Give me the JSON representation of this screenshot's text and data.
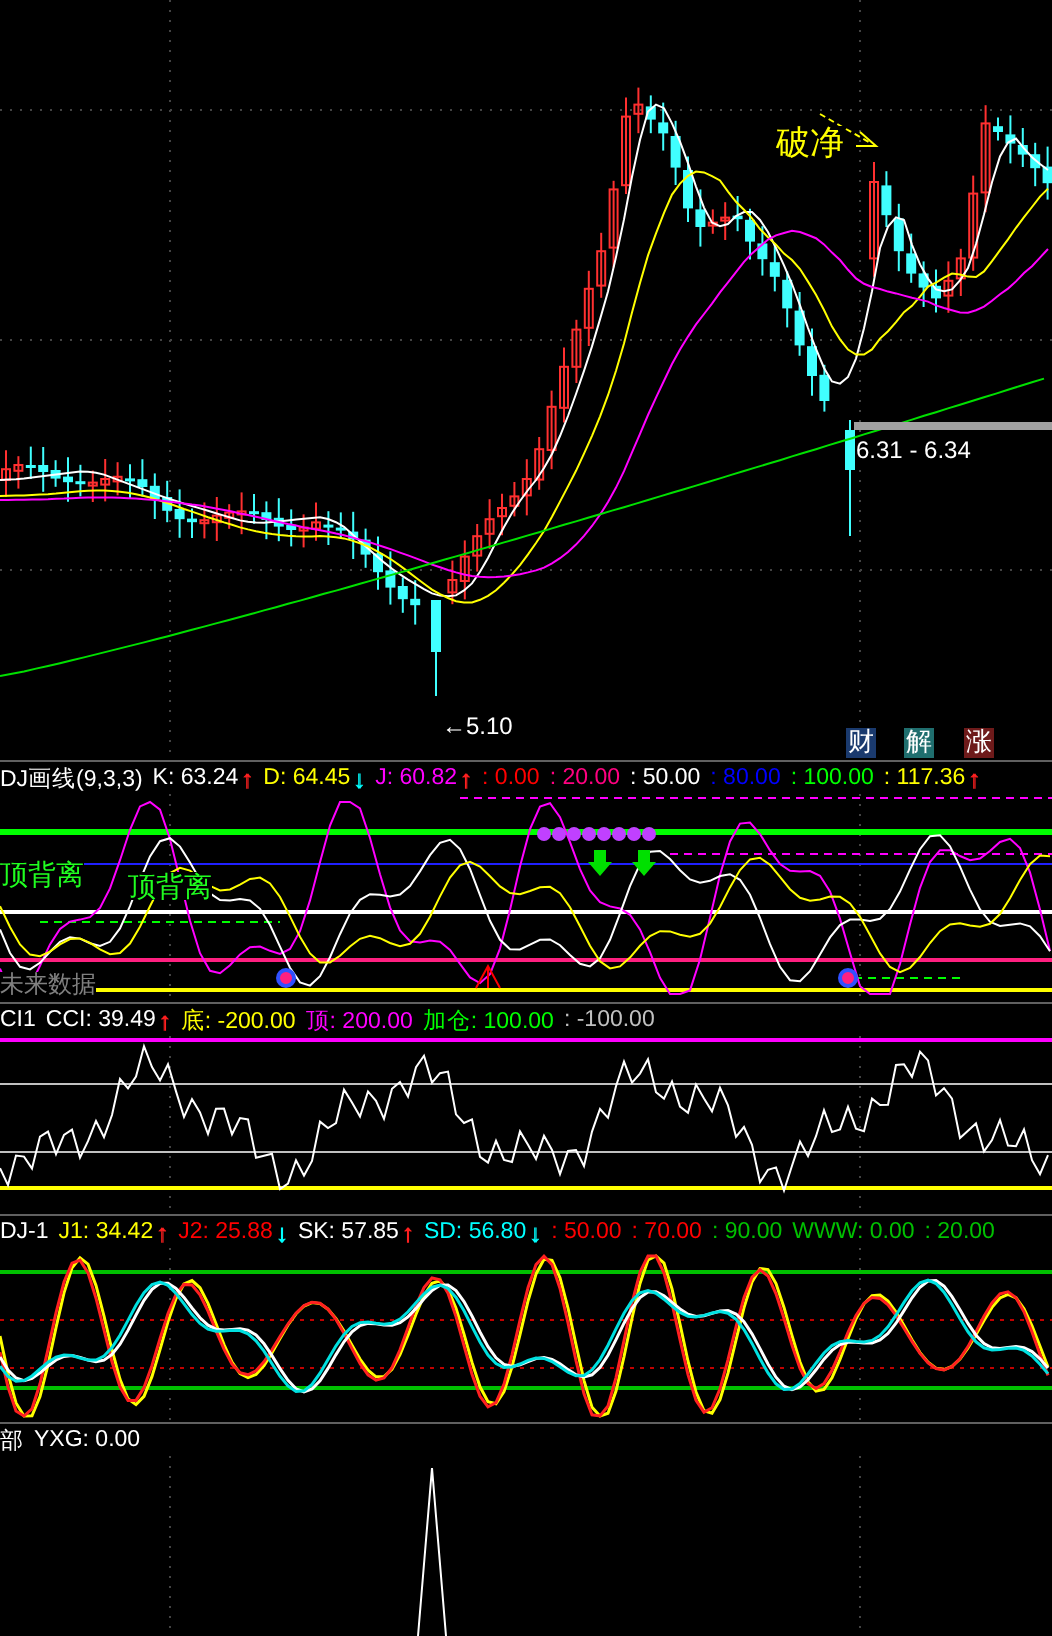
{
  "panels": [
    {
      "kind": "price",
      "annotations": [
        {
          "kind": "callout",
          "text": "破净"
        },
        {
          "kind": "range",
          "text": "6.31 - 6.34"
        },
        {
          "kind": "low",
          "text": "←5.10"
        }
      ],
      "buttons": [
        {
          "text": "财",
          "color": "#1a3a6e"
        },
        {
          "text": "解",
          "color": "#1f6e6e"
        },
        {
          "text": "涨",
          "color": "#6e1a1a"
        }
      ]
    },
    {
      "kind": "kdj",
      "header": {
        "title": "DJ画线(9,3,3)",
        "items": [
          {
            "text": "K: 63.24",
            "color": "#ffffff",
            "arrow": {
              "text": "↑",
              "color": "#ff2020"
            }
          },
          {
            "text": "D: 64.45",
            "color": "#ffff00",
            "arrow": {
              "text": "↓",
              "color": "#00ffff"
            }
          },
          {
            "text": "J: 60.82",
            "color": "#ff00ff",
            "arrow": {
              "text": "↑",
              "color": "#ff2020"
            }
          },
          {
            "text": ": 0.00",
            "color": "#ff0000"
          },
          {
            "text": ": 20.00",
            "color": "#ff0080"
          },
          {
            "text": ": 50.00",
            "color": "#ffffff"
          },
          {
            "text": ": 80.00",
            "color": "#0000ff"
          },
          {
            "text": ": 100.00",
            "color": "#00ff00"
          },
          {
            "text": ": 117.36",
            "color": "#ffff00",
            "arrow": {
              "text": "↑",
              "color": "#ff2020"
            }
          }
        ]
      },
      "labels": [
        {
          "kind": "signal",
          "text": "顶背离"
        },
        {
          "kind": "signal",
          "text": "顶背离"
        },
        {
          "kind": "note",
          "text": "未来数据"
        }
      ]
    },
    {
      "kind": "cci",
      "header": {
        "title": "CI1",
        "items": [
          {
            "text": "CCI: 39.49",
            "color": "#ffffff",
            "arrow": {
              "text": "↑",
              "color": "#ff2020"
            }
          },
          {
            "text": "底: -200.00",
            "color": "#ffff00"
          },
          {
            "text": "顶: 200.00",
            "color": "#ff00ff"
          },
          {
            "text": "加仓: 100.00",
            "color": "#00ff00"
          },
          {
            "text": ": -100.00",
            "color": "#c0c0c0"
          }
        ]
      }
    },
    {
      "kind": "kdj1",
      "header": {
        "title": "DJ-1",
        "items": [
          {
            "text": "J1: 34.42",
            "color": "#ffff00",
            "arrow": {
              "text": "↑",
              "color": "#ff2020"
            }
          },
          {
            "text": "J2: 25.88",
            "color": "#ff0000",
            "arrow": {
              "text": "↓",
              "color": "#00ffff"
            }
          },
          {
            "text": "SK: 57.85",
            "color": "#ffffff",
            "arrow": {
              "text": "↑",
              "color": "#ff2020"
            }
          },
          {
            "text": "SD: 56.80",
            "color": "#00ffff",
            "arrow": {
              "text": "↓",
              "color": "#00ffff"
            }
          },
          {
            "text": ": 50.00",
            "color": "#ff0000"
          },
          {
            "text": ": 70.00",
            "color": "#ff0000"
          },
          {
            "text": ": 90.00",
            "color": "#00c000"
          },
          {
            "text": "WWW: 0.00",
            "color": "#00c000"
          },
          {
            "text": ": 20.00",
            "color": "#00c000"
          }
        ]
      }
    },
    {
      "kind": "yxg",
      "header": {
        "title": "部",
        "items": [
          {
            "text": "YXG: 0.00",
            "color": "#ffffff"
          }
        ]
      }
    }
  ]
}
